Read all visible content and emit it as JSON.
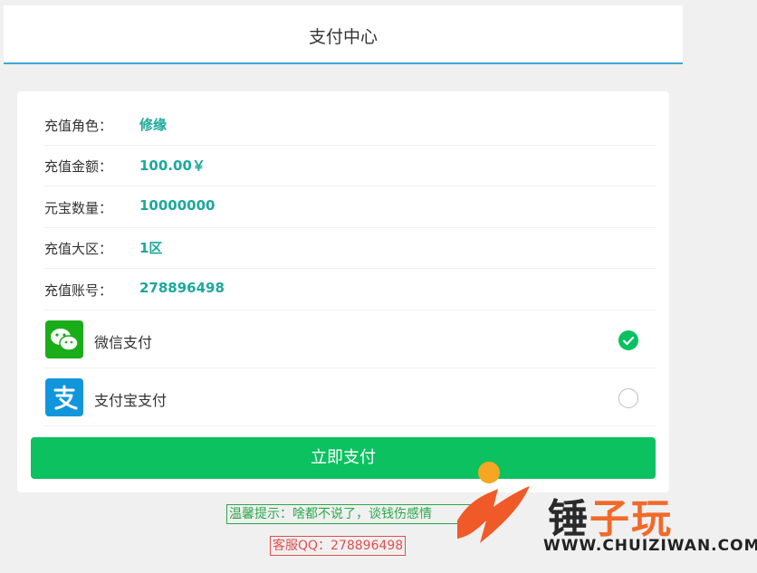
{
  "header": {
    "title": "支付中心"
  },
  "order": {
    "rows": [
      {
        "label": "充值角色：",
        "value": "修缘"
      },
      {
        "label": "充值金额：",
        "value": "100.00￥"
      },
      {
        "label": "元宝数量：",
        "value": "10000000"
      },
      {
        "label": "充值大区：",
        "value": "1区"
      },
      {
        "label": "充值账号：",
        "value": "278896498"
      }
    ]
  },
  "payment_methods": [
    {
      "label": "微信支付",
      "icon": "wechat-icon",
      "selected": true,
      "color": "#1aad19"
    },
    {
      "label": "支付宝支付",
      "icon": "alipay-icon",
      "selected": false,
      "color": "#1296db"
    }
  ],
  "pay_button": {
    "label": "立即支付",
    "color": "#0bc160"
  },
  "tip": {
    "text": "温馨提示：啥都不说了，谈钱伤感情"
  },
  "service": {
    "text": "客服QQ：278896498"
  },
  "watermark": {
    "brand": "锤子玩",
    "url": "WWW.CHUIZIWAN.COM",
    "icon": "hammer-logo-icon"
  }
}
